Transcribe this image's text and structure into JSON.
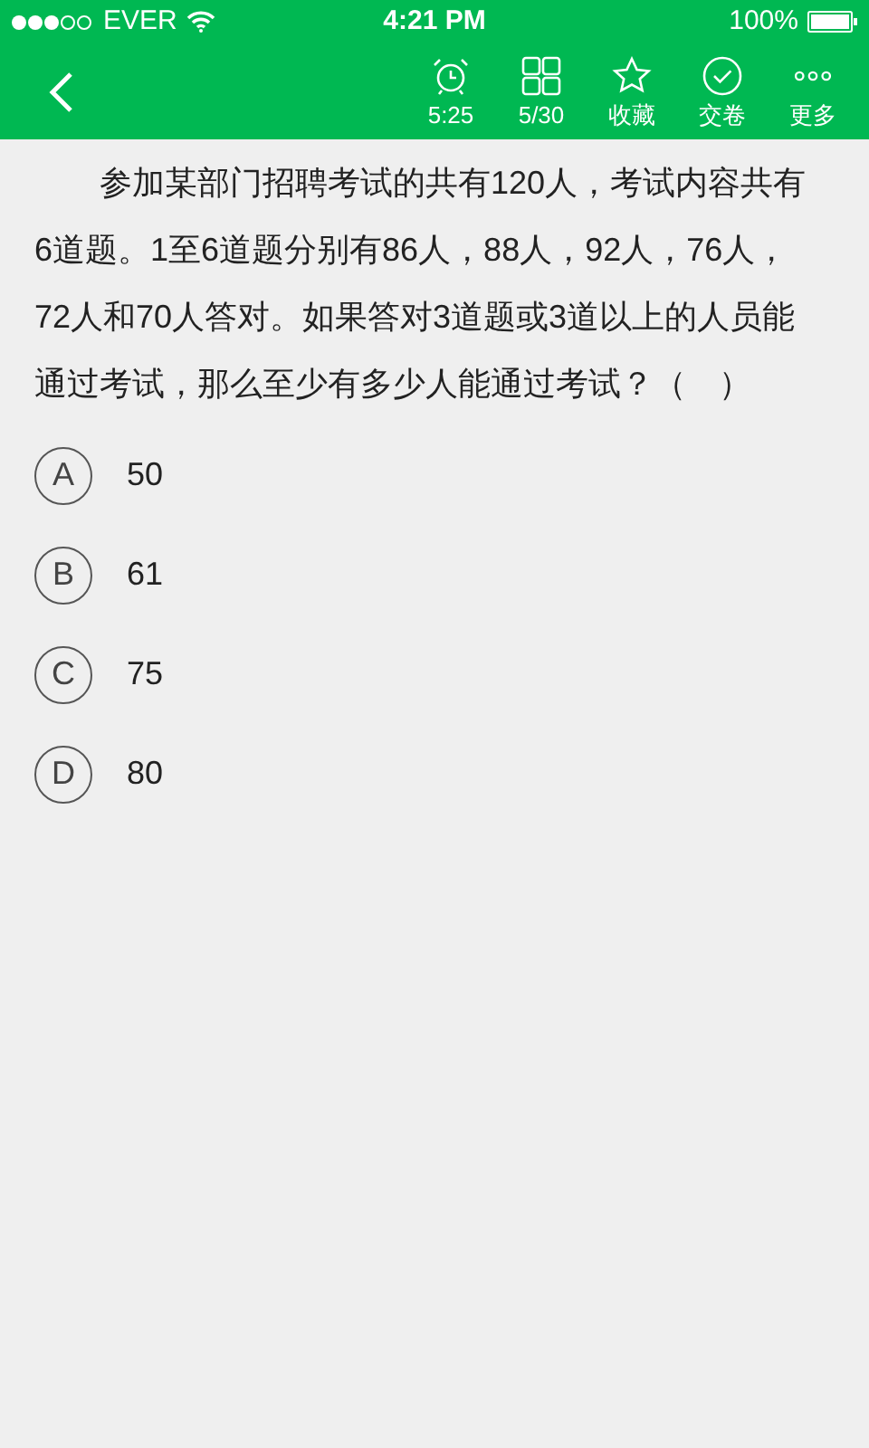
{
  "status_bar": {
    "carrier": "EVER",
    "time": "4:21 PM",
    "battery": "100%"
  },
  "toolbar": {
    "items": [
      {
        "kind": "timer",
        "label": "5:25"
      },
      {
        "kind": "grid",
        "label": "5/30"
      },
      {
        "kind": "star",
        "label": "收藏"
      },
      {
        "kind": "check",
        "label": "交卷"
      },
      {
        "kind": "more",
        "label": "更多"
      }
    ]
  },
  "question": {
    "text": "参加某部门招聘考试的共有120人，考试内容共有6道题。1至6道题分别有86人，88人，92人，76人，72人和70人答对。如果答对3道题或3道以上的人员能通过考试，那么至少有多少人能通过考试？（　）"
  },
  "options": [
    {
      "letter": "A",
      "text": "50",
      "selected": false
    },
    {
      "letter": "B",
      "text": "61",
      "selected": false
    },
    {
      "letter": "C",
      "text": "75",
      "selected": false
    },
    {
      "letter": "D",
      "text": "80",
      "selected": false
    }
  ]
}
